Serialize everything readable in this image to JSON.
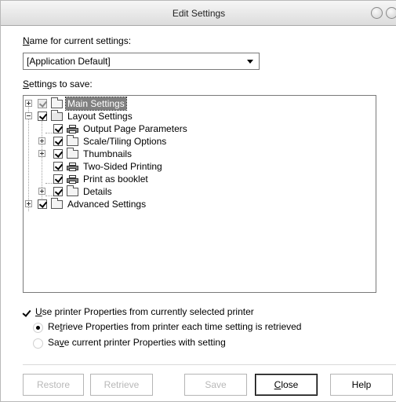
{
  "window": {
    "title": "Edit Settings"
  },
  "name_label": "Name for current settings:",
  "name_label_mnemonic": "N",
  "name_label_rest": "ame for current settings:",
  "settings_dropdown": {
    "value": "[Application Default]"
  },
  "settings_label_mnemonic": "S",
  "settings_label_rest": "ettings to save:",
  "tree": {
    "main_settings": "Main Settings",
    "layout_settings": "Layout Settings",
    "output_page_parameters": "Output Page Parameters",
    "scale_tiling_options": "Scale/Tiling Options",
    "thumbnails": "Thumbnails",
    "two_sided_printing": "Two-Sided Printing",
    "print_as_booklet": "Print as booklet",
    "details": "Details",
    "advanced_settings": "Advanced Settings"
  },
  "printer_props": {
    "checkbox_mnemonic": "U",
    "checkbox_rest": "se printer Properties from currently selected printer",
    "retrieve_pre": "Re",
    "retrieve_mnemonic": "t",
    "retrieve_rest": "rieve Properties from printer each time setting is retrieved",
    "save_pre": "Sa",
    "save_mnemonic": "v",
    "save_rest": "e current printer Properties with setting"
  },
  "buttons": {
    "restore": "Restore",
    "retrieve": "Retrieve",
    "save": "Save",
    "close": "Close",
    "close_mnemonic": "C",
    "close_rest": "lose",
    "help": "Help"
  }
}
